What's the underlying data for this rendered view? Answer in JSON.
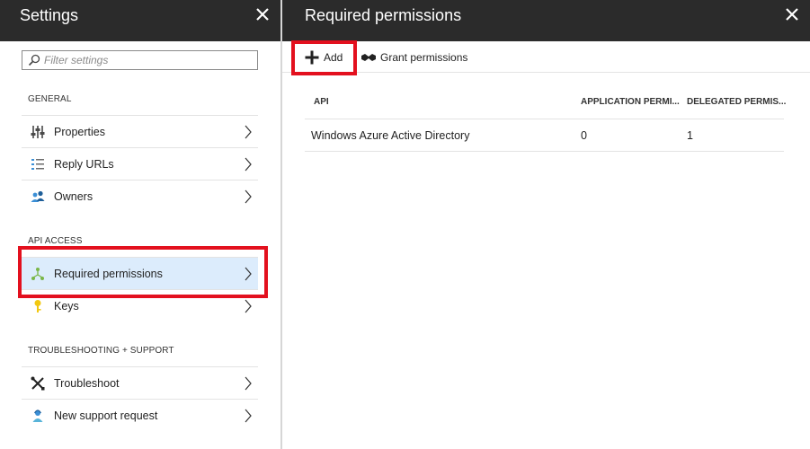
{
  "settings": {
    "title": "Settings",
    "filter_placeholder": "Filter settings",
    "sections": {
      "general": "GENERAL",
      "api_access": "API ACCESS",
      "troubleshooting": "TROUBLESHOOTING + SUPPORT"
    },
    "items": {
      "properties": "Properties",
      "reply_urls": "Reply URLs",
      "owners": "Owners",
      "required_permissions": "Required permissions",
      "keys": "Keys",
      "troubleshoot": "Troubleshoot",
      "new_support_request": "New support request"
    }
  },
  "required_permissions": {
    "title": "Required permissions",
    "toolbar": {
      "add_label": "Add",
      "grant_label": "Grant permissions"
    },
    "table": {
      "headers": [
        "API",
        "APPLICATION PERMI...",
        "DELEGATED PERMIS..."
      ],
      "rows": [
        [
          "Windows Azure Active Directory",
          "0",
          "1"
        ]
      ]
    }
  },
  "colors": {
    "header_bg": "#2b2b2b",
    "selected_bg": "#dcecfc",
    "highlight_red": "#e3101e"
  }
}
